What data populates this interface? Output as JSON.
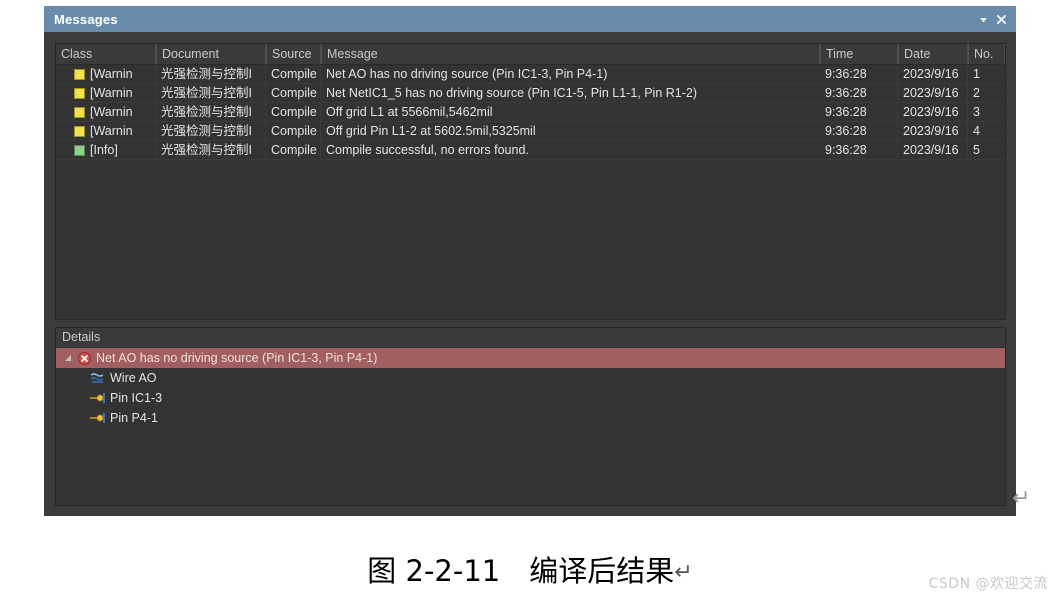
{
  "window": {
    "title": "Messages",
    "titlebar_buttons": [
      {
        "name": "dropdown-button",
        "glyph": "▼"
      },
      {
        "name": "close-button",
        "glyph": "✕"
      }
    ]
  },
  "messages_grid": {
    "columns": [
      {
        "key": "class",
        "label": "Class"
      },
      {
        "key": "document",
        "label": "Document"
      },
      {
        "key": "source",
        "label": "Source"
      },
      {
        "key": "message",
        "label": "Message"
      },
      {
        "key": "time",
        "label": "Time"
      },
      {
        "key": "date",
        "label": "Date"
      },
      {
        "key": "no",
        "label": "No."
      }
    ],
    "rows": [
      {
        "swatch": "#f0e24a",
        "class": "[Warnin",
        "document": "光强检测与控制I",
        "source": "Compile",
        "message": "Net AO has no driving source (Pin IC1-3, Pin P4-1)",
        "time": "9:36:28",
        "date": "2023/9/16",
        "no": "1"
      },
      {
        "swatch": "#f0e24a",
        "class": "[Warnin",
        "document": "光强检测与控制I",
        "source": "Compile",
        "message": "Net NetIC1_5 has no driving source (Pin IC1-5, Pin L1-1, Pin R1-2)",
        "time": "9:36:28",
        "date": "2023/9/16",
        "no": "2"
      },
      {
        "swatch": "#f0e24a",
        "class": "[Warnin",
        "document": "光强检测与控制I",
        "source": "Compile",
        "message": "Off grid L1 at 5566mil,5462mil",
        "time": "9:36:28",
        "date": "2023/9/16",
        "no": "3"
      },
      {
        "swatch": "#f0e24a",
        "class": "[Warnin",
        "document": "光强检测与控制I",
        "source": "Compile",
        "message": "Off grid Pin L1-2 at 5602.5mil,5325mil",
        "time": "9:36:28",
        "date": "2023/9/16",
        "no": "4"
      },
      {
        "swatch": "#8fd08a",
        "class": "[Info]",
        "document": "光强检测与控制I",
        "source": "Compile",
        "message": "Compile successful, no errors found.",
        "time": "9:36:28",
        "date": "2023/9/16",
        "no": "5"
      }
    ]
  },
  "details": {
    "header": "Details",
    "root": {
      "caret": "◢",
      "icon": "error-icon",
      "label": "Net AO has no driving source (Pin IC1-3, Pin P4-1)",
      "selected": true
    },
    "children": [
      {
        "icon": "wire-icon",
        "label": "Wire AO"
      },
      {
        "icon": "pin-icon",
        "label": "Pin IC1-3"
      },
      {
        "icon": "pin-icon",
        "label": "Pin P4-1"
      }
    ]
  },
  "caption": {
    "text": "图 2-2-11 编译后结果",
    "pilcrow": "↵"
  },
  "return_mark": "↵",
  "watermark": "CSDN @欢迎交流",
  "colors": {
    "titlebar": "#6a8cab",
    "panel_bg": "#3c3c3c",
    "grid_bg": "#333333",
    "selected_row": "#a25f5f",
    "warning_swatch": "#f0e24a",
    "info_swatch": "#8fd08a"
  }
}
